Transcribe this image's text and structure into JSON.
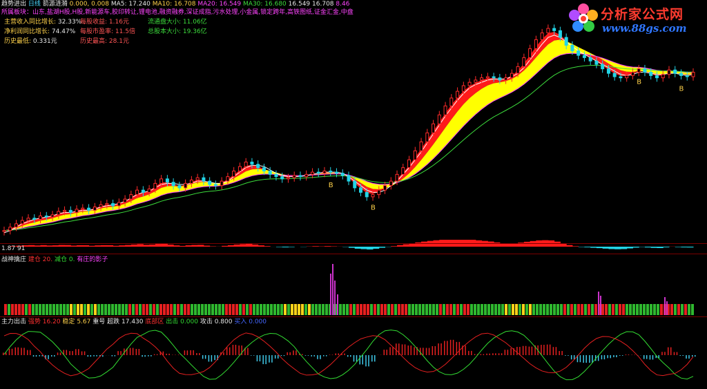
{
  "header": {
    "title": "趋势进出",
    "period": "日线",
    "subtitle": "箭源涟漪",
    "values": "0.000, 0.008",
    "ma5": "MA5: 17.240",
    "ma10": "MA10: 16.708",
    "ma20": "MA20: 16.549",
    "ma30": "MA30: 16.680",
    "extra1": "16.549",
    "extra2": "16.708",
    "extra3": "8.46"
  },
  "sectors": "所属板块：山东,盐湖H股,H股,新能源车,胶印转让,锂电池,融资融券,深证成指,污水处理,小金属,锁定跨年,高铁图纸,证金汇金,中盘",
  "info": {
    "left": [
      {
        "label": "主营收入同比增长:",
        "value": "32.33%"
      },
      {
        "label": "净利润同比增长:",
        "value": "74.47%"
      },
      {
        "label": "历史最低:",
        "value": "0.331元"
      }
    ],
    "mid": [
      {
        "label": "每股收益:",
        "value": "1.16元"
      },
      {
        "label": "每股市盈率:",
        "value": "11.5倍"
      },
      {
        "label": "历史最高:",
        "value": "28.1元"
      }
    ],
    "right": [
      {
        "label": "流通盘大小:",
        "value": "11.06亿"
      },
      {
        "label": "总股本大小:",
        "value": "19.36亿"
      }
    ]
  },
  "logo": {
    "name": "分析家公式网",
    "url": "www.88gs.com"
  },
  "panel1": {
    "label": "1.87 91",
    "markers": [
      "B",
      "B",
      "B",
      "B"
    ]
  },
  "panel2": {
    "title": "战神擒庄",
    "items": [
      {
        "label": "建仓",
        "value": "20.",
        "color": "#ff3030"
      },
      {
        "label": "减仓",
        "value": "0.",
        "color": "#33dd33"
      },
      {
        "label": "有庄的影子",
        "value": "",
        "color": "#ff44ff"
      }
    ]
  },
  "panel3": {
    "title": "主力出击",
    "items": [
      {
        "label": "强势",
        "value": "16.20",
        "color": "#ff3030"
      },
      {
        "label": "稳定",
        "value": "5.67",
        "color": "#ffd24a"
      },
      {
        "label": "重号",
        "value": "",
        "color": "#e8e8e8"
      },
      {
        "label": "超跌",
        "value": "17.430",
        "color": "#e8e8e8"
      },
      {
        "label": "底部区",
        "value": "",
        "color": "#ff3030"
      },
      {
        "label": "出击",
        "value": "0.000",
        "color": "#33dd33"
      },
      {
        "label": "攻击",
        "value": "0.800",
        "color": "#e8e8e8"
      },
      {
        "label": "买入",
        "value": "0.000",
        "color": "#4466ff"
      }
    ]
  },
  "colors": {
    "up": "#ff2a2a",
    "down": "#22d4e6",
    "ribbon_red": "#ff1a1a",
    "ribbon_yellow": "#ffff00"
  },
  "chart_data": {
    "type": "candlestick",
    "title": "",
    "close": [
      9.2,
      9.5,
      9.8,
      10.1,
      10.3,
      10.2,
      10.5,
      10.4,
      10.6,
      10.9,
      11.0,
      10.8,
      11.1,
      11.2,
      11.0,
      11.3,
      11.5,
      11.6,
      11.4,
      11.7,
      12.0,
      12.4,
      12.8,
      12.6,
      12.9,
      13.4,
      13.8,
      13.5,
      13.2,
      13.0,
      13.4,
      13.7,
      13.9,
      13.6,
      13.3,
      13.2,
      13.6,
      14.0,
      14.5,
      14.9,
      15.3,
      15.1,
      14.8,
      14.5,
      14.2,
      14.0,
      13.8,
      13.9,
      14.1,
      14.0,
      14.2,
      14.4,
      14.3,
      14.5,
      14.4,
      14.3,
      14.1,
      13.6,
      13.0,
      12.6,
      12.2,
      12.4,
      12.8,
      13.2,
      13.6,
      14.2,
      14.8,
      15.5,
      16.3,
      17.1,
      17.9,
      18.7,
      19.5,
      20.3,
      21.0,
      21.6,
      22.1,
      22.4,
      22.6,
      22.8,
      22.9,
      22.8,
      22.6,
      22.8,
      23.2,
      23.8,
      24.6,
      25.4,
      26.2,
      26.8,
      27.2,
      27.0,
      26.4,
      25.7,
      25.2,
      24.8,
      24.6,
      24.3,
      24.0,
      23.6,
      23.2,
      22.9,
      22.8,
      23.0,
      23.3,
      23.6,
      23.3,
      23.0,
      22.8,
      23.1,
      23.5,
      23.2,
      23.0,
      22.9,
      23.3
    ],
    "ma_white": [
      9.0,
      9.2,
      9.5,
      9.8,
      10.0,
      10.2,
      10.3,
      10.4,
      10.5,
      10.7,
      10.8,
      10.8,
      10.9,
      11.0,
      11.0,
      11.1,
      11.3,
      11.4,
      11.5,
      11.6,
      11.8,
      12.1,
      12.4,
      12.6,
      12.7,
      13.0,
      13.3,
      13.4,
      13.4,
      13.3,
      13.3,
      13.4,
      13.6,
      13.6,
      13.5,
      13.4,
      13.4,
      13.6,
      14.0,
      14.4,
      14.8,
      15.0,
      15.0,
      14.9,
      14.6,
      14.3,
      14.1,
      14.0,
      14.0,
      14.0,
      14.1,
      14.2,
      14.3,
      14.4,
      14.4,
      14.4,
      14.3,
      14.0,
      13.6,
      13.2,
      12.8,
      12.6,
      12.6,
      12.8,
      13.2,
      13.6,
      14.2,
      14.8,
      15.5,
      16.2,
      17.0,
      17.8,
      18.6,
      19.4,
      20.1,
      20.8,
      21.4,
      21.9,
      22.2,
      22.4,
      22.6,
      22.7,
      22.7,
      22.7,
      22.9,
      23.2,
      23.7,
      24.4,
      25.1,
      25.8,
      26.4,
      26.6,
      26.4,
      26.0,
      25.6,
      25.2,
      24.9,
      24.6,
      24.3,
      24.0,
      23.7,
      23.4,
      23.1,
      23.0,
      23.1,
      23.3,
      23.3,
      23.2,
      23.1,
      23.1,
      23.2,
      23.2,
      23.1,
      23.0,
      23.1
    ],
    "ylim": [
      8.5,
      28.5
    ],
    "markers": [
      {
        "index": 54,
        "label": "B"
      },
      {
        "index": 61,
        "label": "B"
      },
      {
        "index": 105,
        "label": "B"
      },
      {
        "index": 112,
        "label": "B"
      }
    ]
  }
}
